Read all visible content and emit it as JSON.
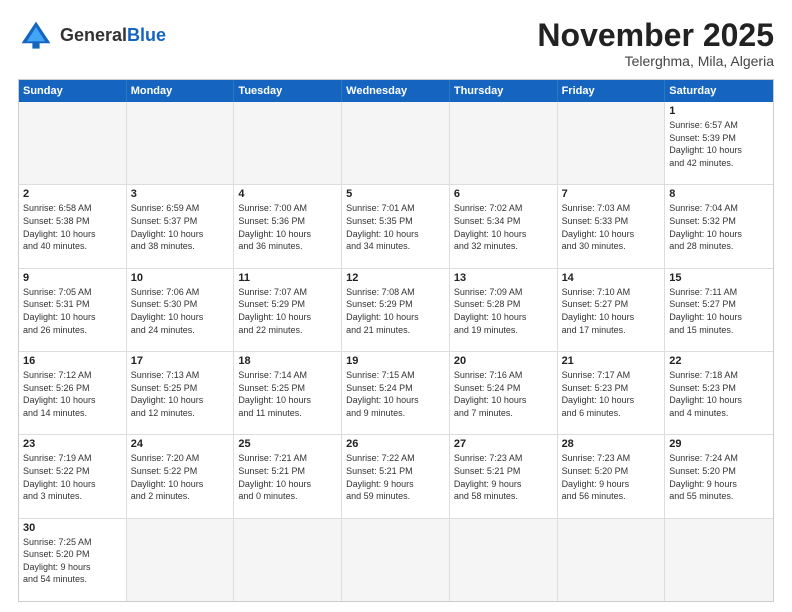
{
  "header": {
    "logo_general": "General",
    "logo_blue": "Blue",
    "month": "November 2025",
    "location": "Telerghma, Mila, Algeria"
  },
  "days_of_week": [
    "Sunday",
    "Monday",
    "Tuesday",
    "Wednesday",
    "Thursday",
    "Friday",
    "Saturday"
  ],
  "weeks": [
    [
      {
        "day": "",
        "info": ""
      },
      {
        "day": "",
        "info": ""
      },
      {
        "day": "",
        "info": ""
      },
      {
        "day": "",
        "info": ""
      },
      {
        "day": "",
        "info": ""
      },
      {
        "day": "",
        "info": ""
      },
      {
        "day": "1",
        "info": "Sunrise: 6:57 AM\nSunset: 5:39 PM\nDaylight: 10 hours\nand 42 minutes."
      }
    ],
    [
      {
        "day": "2",
        "info": "Sunrise: 6:58 AM\nSunset: 5:38 PM\nDaylight: 10 hours\nand 40 minutes."
      },
      {
        "day": "3",
        "info": "Sunrise: 6:59 AM\nSunset: 5:37 PM\nDaylight: 10 hours\nand 38 minutes."
      },
      {
        "day": "4",
        "info": "Sunrise: 7:00 AM\nSunset: 5:36 PM\nDaylight: 10 hours\nand 36 minutes."
      },
      {
        "day": "5",
        "info": "Sunrise: 7:01 AM\nSunset: 5:35 PM\nDaylight: 10 hours\nand 34 minutes."
      },
      {
        "day": "6",
        "info": "Sunrise: 7:02 AM\nSunset: 5:34 PM\nDaylight: 10 hours\nand 32 minutes."
      },
      {
        "day": "7",
        "info": "Sunrise: 7:03 AM\nSunset: 5:33 PM\nDaylight: 10 hours\nand 30 minutes."
      },
      {
        "day": "8",
        "info": "Sunrise: 7:04 AM\nSunset: 5:32 PM\nDaylight: 10 hours\nand 28 minutes."
      }
    ],
    [
      {
        "day": "9",
        "info": "Sunrise: 7:05 AM\nSunset: 5:31 PM\nDaylight: 10 hours\nand 26 minutes."
      },
      {
        "day": "10",
        "info": "Sunrise: 7:06 AM\nSunset: 5:30 PM\nDaylight: 10 hours\nand 24 minutes."
      },
      {
        "day": "11",
        "info": "Sunrise: 7:07 AM\nSunset: 5:29 PM\nDaylight: 10 hours\nand 22 minutes."
      },
      {
        "day": "12",
        "info": "Sunrise: 7:08 AM\nSunset: 5:29 PM\nDaylight: 10 hours\nand 21 minutes."
      },
      {
        "day": "13",
        "info": "Sunrise: 7:09 AM\nSunset: 5:28 PM\nDaylight: 10 hours\nand 19 minutes."
      },
      {
        "day": "14",
        "info": "Sunrise: 7:10 AM\nSunset: 5:27 PM\nDaylight: 10 hours\nand 17 minutes."
      },
      {
        "day": "15",
        "info": "Sunrise: 7:11 AM\nSunset: 5:27 PM\nDaylight: 10 hours\nand 15 minutes."
      }
    ],
    [
      {
        "day": "16",
        "info": "Sunrise: 7:12 AM\nSunset: 5:26 PM\nDaylight: 10 hours\nand 14 minutes."
      },
      {
        "day": "17",
        "info": "Sunrise: 7:13 AM\nSunset: 5:25 PM\nDaylight: 10 hours\nand 12 minutes."
      },
      {
        "day": "18",
        "info": "Sunrise: 7:14 AM\nSunset: 5:25 PM\nDaylight: 10 hours\nand 11 minutes."
      },
      {
        "day": "19",
        "info": "Sunrise: 7:15 AM\nSunset: 5:24 PM\nDaylight: 10 hours\nand 9 minutes."
      },
      {
        "day": "20",
        "info": "Sunrise: 7:16 AM\nSunset: 5:24 PM\nDaylight: 10 hours\nand 7 minutes."
      },
      {
        "day": "21",
        "info": "Sunrise: 7:17 AM\nSunset: 5:23 PM\nDaylight: 10 hours\nand 6 minutes."
      },
      {
        "day": "22",
        "info": "Sunrise: 7:18 AM\nSunset: 5:23 PM\nDaylight: 10 hours\nand 4 minutes."
      }
    ],
    [
      {
        "day": "23",
        "info": "Sunrise: 7:19 AM\nSunset: 5:22 PM\nDaylight: 10 hours\nand 3 minutes."
      },
      {
        "day": "24",
        "info": "Sunrise: 7:20 AM\nSunset: 5:22 PM\nDaylight: 10 hours\nand 2 minutes."
      },
      {
        "day": "25",
        "info": "Sunrise: 7:21 AM\nSunset: 5:21 PM\nDaylight: 10 hours\nand 0 minutes."
      },
      {
        "day": "26",
        "info": "Sunrise: 7:22 AM\nSunset: 5:21 PM\nDaylight: 9 hours\nand 59 minutes."
      },
      {
        "day": "27",
        "info": "Sunrise: 7:23 AM\nSunset: 5:21 PM\nDaylight: 9 hours\nand 58 minutes."
      },
      {
        "day": "28",
        "info": "Sunrise: 7:23 AM\nSunset: 5:20 PM\nDaylight: 9 hours\nand 56 minutes."
      },
      {
        "day": "29",
        "info": "Sunrise: 7:24 AM\nSunset: 5:20 PM\nDaylight: 9 hours\nand 55 minutes."
      }
    ],
    [
      {
        "day": "30",
        "info": "Sunrise: 7:25 AM\nSunset: 5:20 PM\nDaylight: 9 hours\nand 54 minutes."
      },
      {
        "day": "",
        "info": ""
      },
      {
        "day": "",
        "info": ""
      },
      {
        "day": "",
        "info": ""
      },
      {
        "day": "",
        "info": ""
      },
      {
        "day": "",
        "info": ""
      },
      {
        "day": "",
        "info": ""
      }
    ]
  ]
}
